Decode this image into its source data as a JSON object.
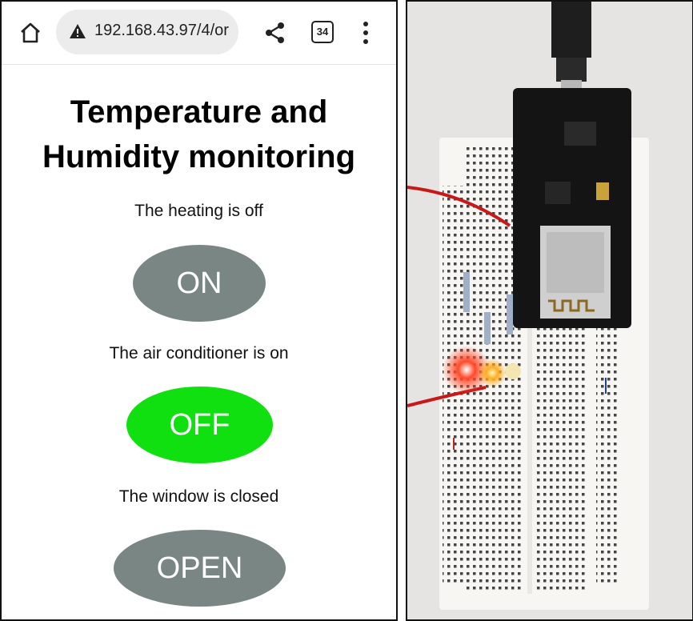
{
  "browser": {
    "url": "192.168.43.97/4/or",
    "tab_count": "34",
    "icons": [
      "home-icon",
      "warning-icon",
      "share-icon",
      "tab-count-icon",
      "more-menu-icon"
    ]
  },
  "page": {
    "title_line1": "Temperature and",
    "title_line2": "Humidity monitoring",
    "heating_status": "The heating is off",
    "heating_button": "ON",
    "ac_status": "The air conditioner is on",
    "ac_button": "OFF",
    "window_status": "The window is closed",
    "window_button": "OPEN"
  },
  "colors": {
    "button_grey": "#7a8683",
    "button_green": "#10e010"
  }
}
